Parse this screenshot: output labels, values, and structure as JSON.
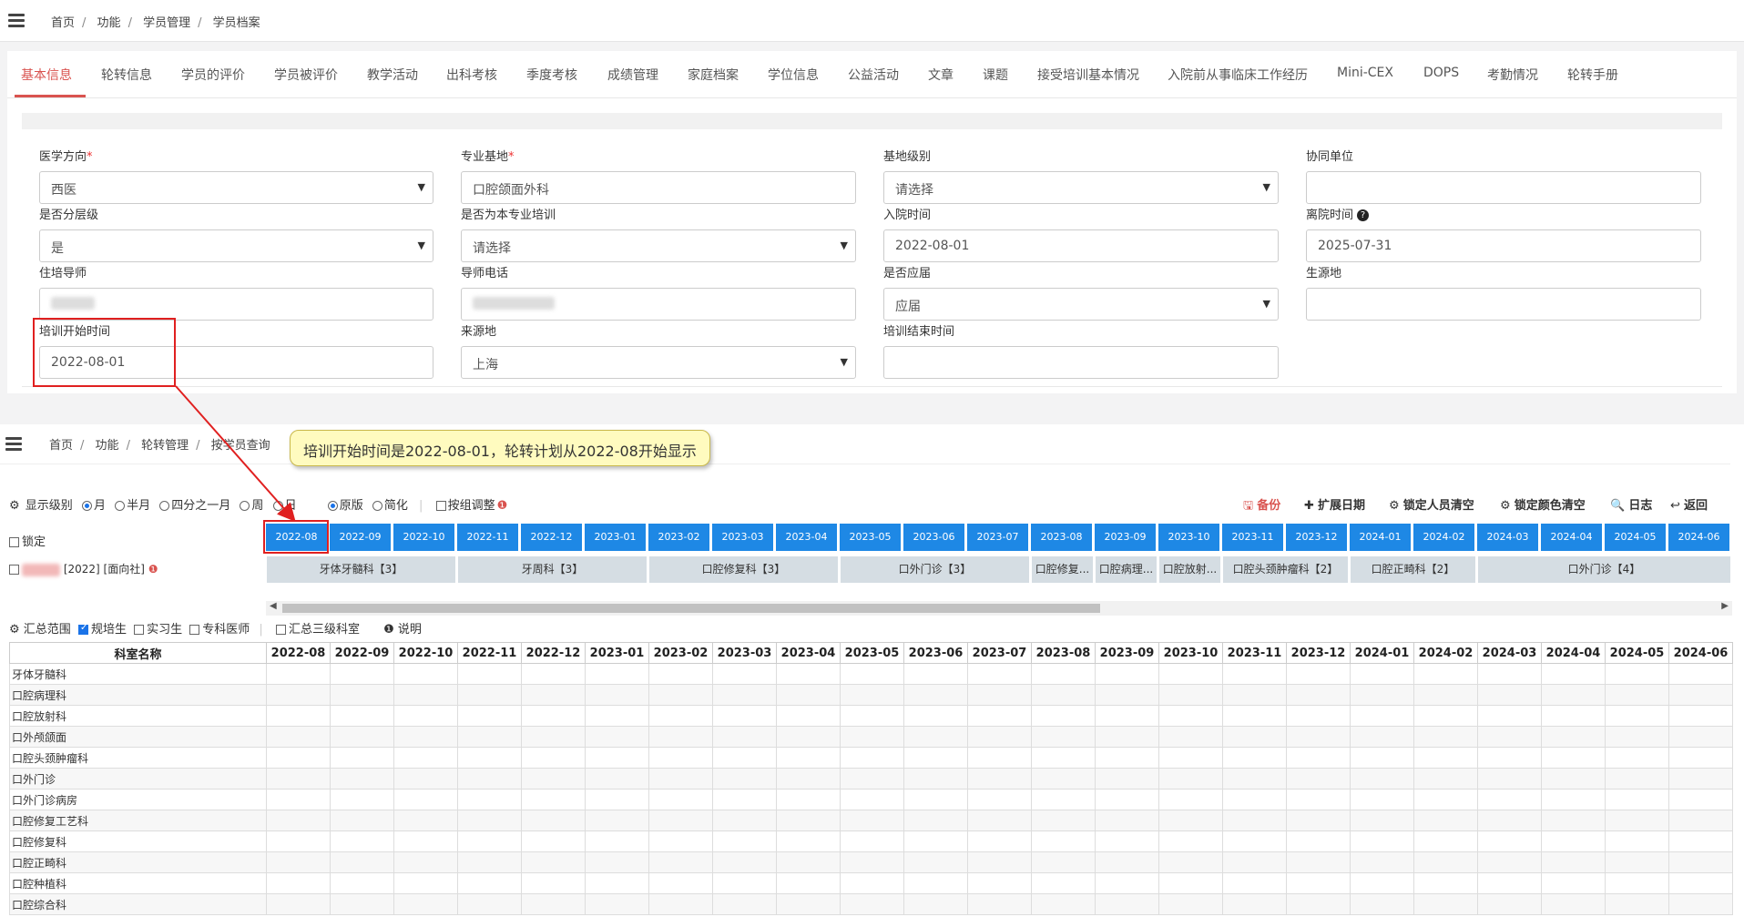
{
  "breadcrumb1": [
    "首页",
    "功能",
    "学员管理",
    "学员档案"
  ],
  "tabs": [
    "基本信息",
    "轮转信息",
    "学员的评价",
    "学员被评价",
    "教学活动",
    "出科考核",
    "季度考核",
    "成绩管理",
    "家庭档案",
    "学位信息",
    "公益活动",
    "文章",
    "课题",
    "接受培训基本情况",
    "入院前从事临床工作经历",
    "Mini-CEX",
    "DOPS",
    "考勤情况",
    "轮转手册"
  ],
  "fields": {
    "f1": {
      "label": "医学方向",
      "required": true,
      "value": "西医",
      "select": true
    },
    "f2": {
      "label": "专业基地",
      "required": true,
      "value": "口腔颌面外科",
      "select": false
    },
    "f3": {
      "label": "基地级别",
      "required": false,
      "value": "请选择",
      "select": true
    },
    "f4": {
      "label": "协同单位",
      "required": false,
      "value": "",
      "select": false
    },
    "f5": {
      "label": "是否分层级",
      "required": false,
      "value": "是",
      "select": true
    },
    "f6": {
      "label": "是否为本专业培训",
      "required": false,
      "value": "请选择",
      "select": true
    },
    "f7": {
      "label": "入院时间",
      "required": false,
      "value": "2022-08-01",
      "select": false
    },
    "f8": {
      "label": "离院时间",
      "required": false,
      "value": "2025-07-31",
      "select": false
    },
    "f9": {
      "label": "住培导师",
      "required": false,
      "value": "",
      "select": false
    },
    "f10": {
      "label": "导师电话",
      "required": false,
      "value": "",
      "select": false
    },
    "f11": {
      "label": "是否应届",
      "required": false,
      "value": "应届",
      "select": true
    },
    "f12": {
      "label": "生源地",
      "required": false,
      "value": "",
      "select": false
    },
    "f13": {
      "label": "培训开始时间",
      "required": false,
      "value": "2022-08-01",
      "select": false
    },
    "f14": {
      "label": "来源地",
      "required": false,
      "value": "上海",
      "select": true
    },
    "f15": {
      "label": "培训结束时间",
      "required": false,
      "value": "",
      "select": false
    }
  },
  "breadcrumb2": [
    "首页",
    "功能",
    "轮转管理",
    "按学员查询"
  ],
  "callout": "培训开始时间是2022-08-01，轮转计划从2022-08开始显示",
  "toolbar": {
    "level_label": "显示级别",
    "options": [
      "月",
      "半月",
      "四分之一月",
      "周",
      "日"
    ],
    "view_options": [
      "原版",
      "简化"
    ],
    "group_adjust": "按组调整"
  },
  "right_tools": {
    "backup": "备份",
    "extend": "扩展日期",
    "lock_clear": "锁定人员清空",
    "color_clear": "锁定颜色清空",
    "log": "日志",
    "back": "返回"
  },
  "lock_label": "锁定",
  "student_suffix": "[2022] [面向社]",
  "months": [
    "2022-08",
    "2022-09",
    "2022-10",
    "2022-11",
    "2022-12",
    "2023-01",
    "2023-02",
    "2023-03",
    "2023-04",
    "2023-05",
    "2023-06",
    "2023-07",
    "2023-08",
    "2023-09",
    "2023-10",
    "2023-11",
    "2023-12",
    "2024-01",
    "2024-02",
    "2024-03",
    "2024-04",
    "2024-05",
    "2024-06"
  ],
  "rotations": [
    "牙体牙髓科【3】",
    "牙周科【3】",
    "口腔修复科【3】",
    "口外门诊【3】",
    "口腔修复...",
    "口腔病理...",
    "口腔放射...",
    "口腔头颈肿瘤科【2】",
    "口腔正畸科【2】",
    "口外门诊【4】"
  ],
  "summary": {
    "label": "汇总范围",
    "opt1": "规培生",
    "opt2": "实习生",
    "opt3": "专科医师",
    "opt4": "汇总三级科室",
    "note": "说明"
  },
  "grid_header": "科室名称",
  "departments": [
    "牙体牙髓科",
    "口腔病理科",
    "口腔放射科",
    "口外颅颌面",
    "口腔头颈肿瘤科",
    "口外门诊",
    "口外门诊病房",
    "口腔修复工艺科",
    "口腔修复科",
    "口腔正畸科",
    "口腔种植科",
    "口腔综合科"
  ]
}
